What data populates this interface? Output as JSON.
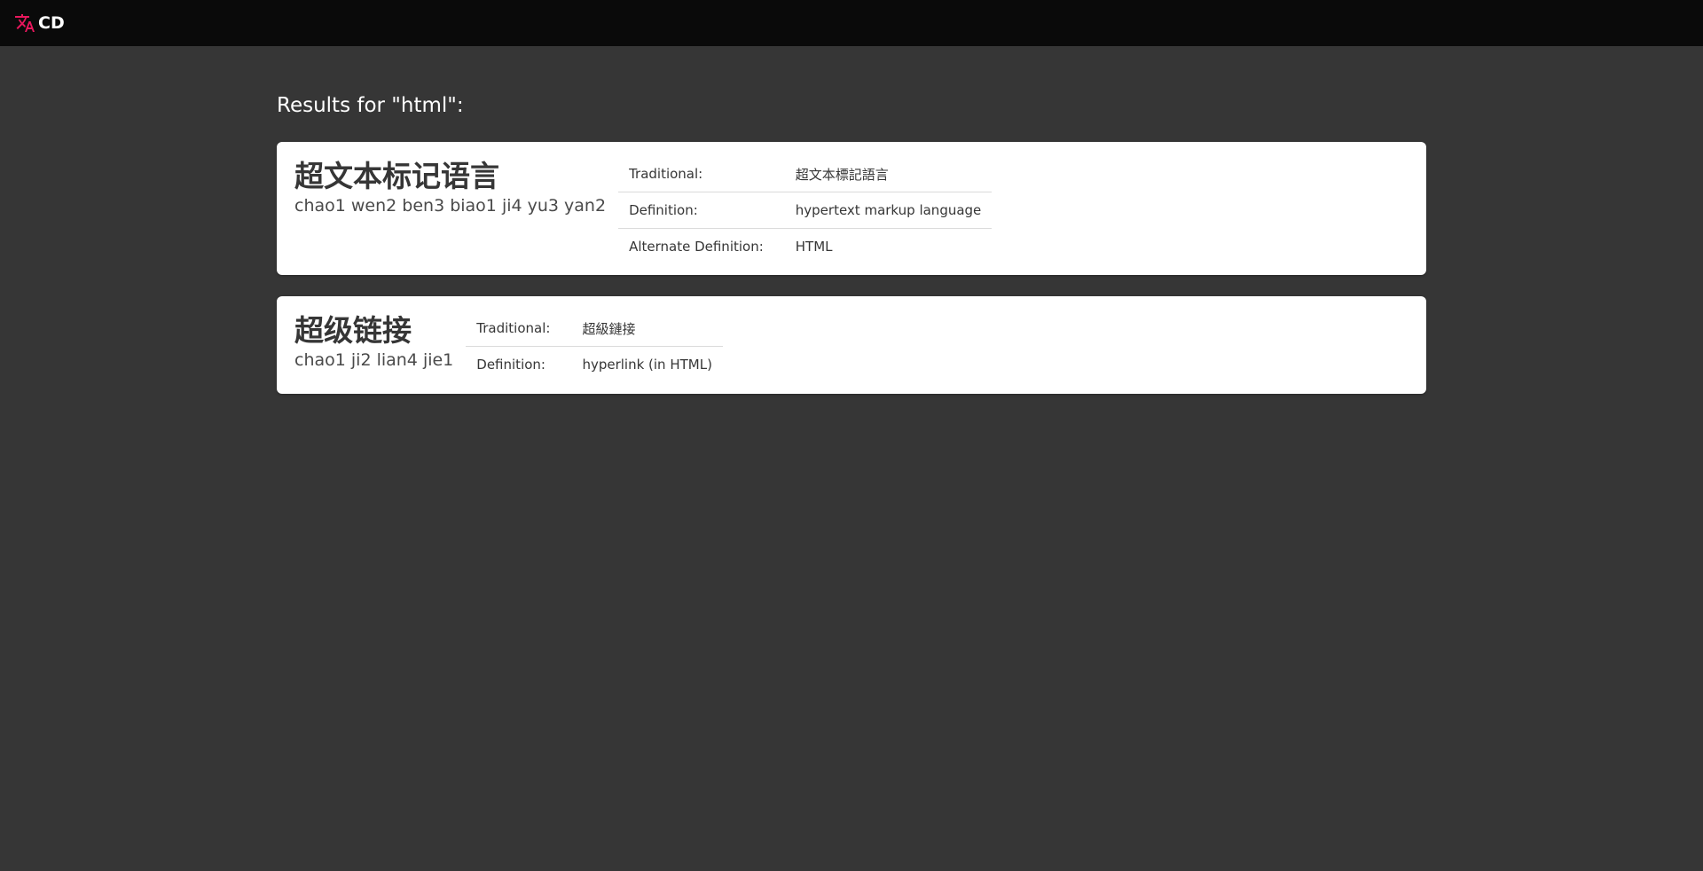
{
  "app": {
    "brand": "CD",
    "brand_icon": "translate-icon",
    "accent_color": "#e8175d"
  },
  "results": {
    "heading": "Results for \"html\":",
    "entries": [
      {
        "simplified": "超文本标记语言",
        "pinyin": "chao1 wen2 ben3 biao1 ji4 yu3 yan2",
        "rows": [
          {
            "label": "Traditional:",
            "value": "超文本標記語言"
          },
          {
            "label": "Definition:",
            "value": "hypertext markup language"
          },
          {
            "label": "Alternate Definition:",
            "value": "HTML"
          }
        ]
      },
      {
        "simplified": "超级链接",
        "pinyin": "chao1 ji2 lian4 jie1",
        "rows": [
          {
            "label": "Traditional:",
            "value": "超級鏈接"
          },
          {
            "label": "Definition:",
            "value": "hyperlink (in HTML)"
          }
        ]
      }
    ]
  }
}
